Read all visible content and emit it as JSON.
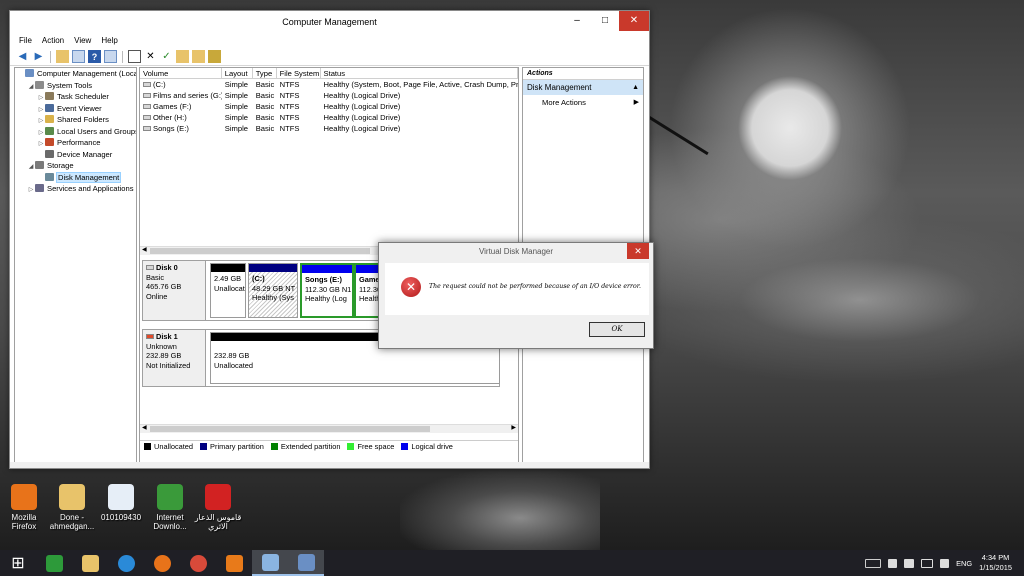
{
  "window": {
    "title": "Computer Management",
    "menu": [
      "File",
      "Action",
      "View",
      "Help"
    ]
  },
  "tree": [
    {
      "label": "Computer Management (Local",
      "indent": 0,
      "expander": "",
      "icon_color": "#6a8fc4"
    },
    {
      "label": "System Tools",
      "indent": 1,
      "expander": "◢",
      "icon_color": "#8c8c8c"
    },
    {
      "label": "Task Scheduler",
      "indent": 2,
      "expander": "▷",
      "icon_color": "#8a7a5a"
    },
    {
      "label": "Event Viewer",
      "indent": 2,
      "expander": "▷",
      "icon_color": "#4a6a9a"
    },
    {
      "label": "Shared Folders",
      "indent": 2,
      "expander": "▷",
      "icon_color": "#d9b24a"
    },
    {
      "label": "Local Users and Groups",
      "indent": 2,
      "expander": "▷",
      "icon_color": "#5a8a4a"
    },
    {
      "label": "Performance",
      "indent": 2,
      "expander": "▷",
      "icon_color": "#c44a2a"
    },
    {
      "label": "Device Manager",
      "indent": 2,
      "expander": "",
      "icon_color": "#6a6a6a"
    },
    {
      "label": "Storage",
      "indent": 1,
      "expander": "◢",
      "icon_color": "#7a7a7a"
    },
    {
      "label": "Disk Management",
      "indent": 2,
      "expander": "",
      "icon_color": "#6a8a9a",
      "selected": true
    },
    {
      "label": "Services and Applications",
      "indent": 1,
      "expander": "▷",
      "icon_color": "#6a6a8a"
    }
  ],
  "volumes": {
    "headers": [
      "Volume",
      "Layout",
      "Type",
      "File System",
      "Status"
    ],
    "rows": [
      [
        "(C:)",
        "Simple",
        "Basic",
        "NTFS",
        "Healthy (System, Boot, Page File, Active, Crash Dump, Pri"
      ],
      [
        "Films and series (G:)",
        "Simple",
        "Basic",
        "NTFS",
        "Healthy (Logical Drive)"
      ],
      [
        "Games (F:)",
        "Simple",
        "Basic",
        "NTFS",
        "Healthy (Logical Drive)"
      ],
      [
        "Other (H:)",
        "Simple",
        "Basic",
        "NTFS",
        "Healthy (Logical Drive)"
      ],
      [
        "Songs (E:)",
        "Simple",
        "Basic",
        "NTFS",
        "Healthy (Logical Drive)"
      ]
    ]
  },
  "disk0": {
    "name": "Disk 0",
    "type": "Basic",
    "size": "465.76 GB",
    "state": "Online",
    "parts": [
      {
        "line1": "",
        "line2": "2.49 GB",
        "line3": "Unallocat"
      },
      {
        "line1": "(C:)",
        "line2": "48.29 GB NT",
        "line3": "Healthy (Sys"
      },
      {
        "line1": "Songs  (E:)",
        "line2": "112.30 GB N1",
        "line3": "Healthy (Log"
      },
      {
        "line1": "Games",
        "line2": "112.30",
        "line3": "Health"
      }
    ]
  },
  "disk1": {
    "name": "Disk 1",
    "type": "Unknown",
    "size": "232.89 GB",
    "state": "Not Initialized",
    "part_size": "232.89 GB",
    "part_state": "Unallocated"
  },
  "legend": [
    {
      "label": "Unallocated",
      "color": "#000000"
    },
    {
      "label": "Primary partition",
      "color": "#000080"
    },
    {
      "label": "Extended partition",
      "color": "#008000"
    },
    {
      "label": "Free space",
      "color": "#33ee33"
    },
    {
      "label": "Logical drive",
      "color": "#0000ee"
    }
  ],
  "actions": {
    "header": "Actions",
    "selected": "Disk Management",
    "more": "More Actions"
  },
  "dialog": {
    "title": "Virtual Disk Manager",
    "message": "The request could not be performed because of an I/O device error.",
    "ok": "OK"
  },
  "desktop_icons": [
    {
      "label": "Mozilla Firefox",
      "icon": "firefox-icon",
      "color": "#e8731a"
    },
    {
      "label": "Done - ahmedgan...",
      "icon": "folder-icon",
      "color": "#e8c36a"
    },
    {
      "label": "010109430",
      "icon": "wav-file-icon",
      "color": "#e6eef7"
    },
    {
      "label": "Internet Downlo...",
      "icon": "internet-download-manager-icon",
      "color": "#3a9a3a"
    },
    {
      "label": "قاموس الذعار الاثري",
      "icon": "pdf-file-icon",
      "color": "#d22222"
    }
  ],
  "taskbar": {
    "buttons": [
      {
        "name": "start-button",
        "icon": "windows-logo-icon",
        "color": "#ffffff"
      },
      {
        "name": "taskbar-store",
        "icon": "store-icon",
        "color": "#2d9a3a"
      },
      {
        "name": "taskbar-file-explorer",
        "icon": "folder-icon",
        "color": "#e8c36a"
      },
      {
        "name": "taskbar-internet-explorer",
        "icon": "internet-explorer-icon",
        "color": "#2a8ad8"
      },
      {
        "name": "taskbar-firefox",
        "icon": "firefox-icon",
        "color": "#e8731a"
      },
      {
        "name": "taskbar-chrome",
        "icon": "chrome-icon",
        "color": "#d84a3a"
      },
      {
        "name": "taskbar-media-player",
        "icon": "media-player-icon",
        "color": "#e87a1a"
      },
      {
        "name": "taskbar-remote-desktop",
        "icon": "remote-desktop-icon",
        "color": "#8ab4e0"
      },
      {
        "name": "taskbar-computer-management",
        "icon": "computer-management-icon",
        "color": "#6a8fc4"
      }
    ],
    "language": "ENG",
    "time": "4:34 PM",
    "date": "1/15/2015"
  }
}
